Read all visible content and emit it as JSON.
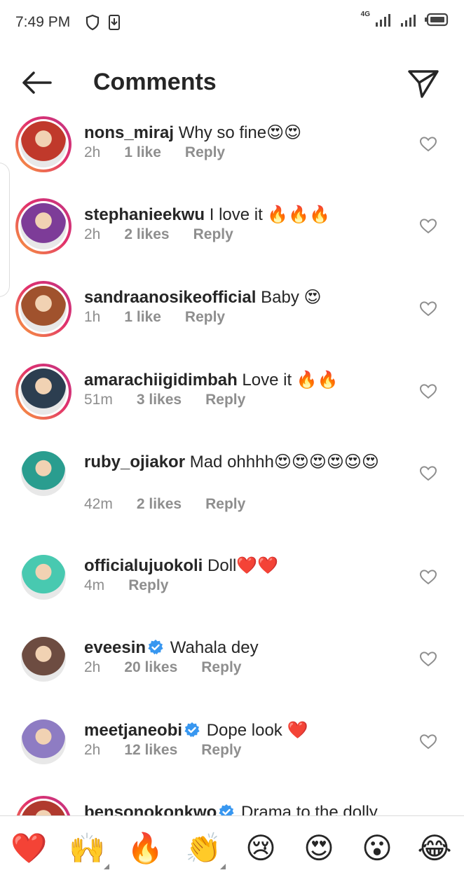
{
  "status": {
    "time": "7:49 PM",
    "network": "4G"
  },
  "header": {
    "title": "Comments"
  },
  "comments": [
    {
      "username": "nons_miraj",
      "text": "Why so fine😍😍",
      "time": "2h",
      "likes": "1 like",
      "reply": "Reply",
      "verified": false,
      "ring": true,
      "color": "#c0392b"
    },
    {
      "username": "stephanieekwu",
      "text": "I love it 🔥🔥🔥",
      "time": "2h",
      "likes": "2 likes",
      "reply": "Reply",
      "verified": false,
      "ring": true,
      "color": "#7d3c98"
    },
    {
      "username": "sandraanosikeofficial",
      "text": "Baby 😍",
      "time": "1h",
      "likes": "1 like",
      "reply": "Reply",
      "verified": false,
      "ring": true,
      "color": "#a0522d"
    },
    {
      "username": "amarachiigidimbah",
      "text": "Love it 🔥🔥",
      "time": "51m",
      "likes": "3 likes",
      "reply": "Reply",
      "verified": false,
      "ring": true,
      "color": "#2c3e50"
    },
    {
      "username": "ruby_ojiakor",
      "text": "Mad ohhhh😍😍😍😍😍😍",
      "time": "42m",
      "likes": "2 likes",
      "reply": "Reply",
      "verified": false,
      "ring": false,
      "color": "#2a9d8f"
    },
    {
      "username": "officialujuokoli",
      "text": "Doll❤️❤️",
      "time": "4m",
      "likes": "",
      "reply": "Reply",
      "verified": false,
      "ring": false,
      "color": "#48c9b0"
    },
    {
      "username": "eveesin",
      "text": "Wahala dey",
      "time": "2h",
      "likes": "20 likes",
      "reply": "Reply",
      "verified": true,
      "ring": false,
      "color": "#6d4c41"
    },
    {
      "username": "meetjaneobi",
      "text": "Dope look ❤️",
      "time": "2h",
      "likes": "12 likes",
      "reply": "Reply",
      "verified": true,
      "ring": false,
      "color": "#8e7cc3"
    },
    {
      "username": "bensonokonkwo",
      "text": "Drama to the dolly",
      "time": "",
      "likes": "",
      "reply": "",
      "verified": true,
      "ring": true,
      "color": "#b03a2e"
    }
  ],
  "reactions": [
    {
      "emoji": "❤️",
      "name": "red-heart"
    },
    {
      "emoji": "🙌",
      "name": "raising-hands"
    },
    {
      "emoji": "🔥",
      "name": "fire"
    },
    {
      "emoji": "👏",
      "name": "clapping-hands"
    },
    {
      "emoji": "😢",
      "name": "crying-face"
    },
    {
      "emoji": "😍",
      "name": "heart-eyes"
    },
    {
      "emoji": "😮",
      "name": "open-mouth"
    },
    {
      "emoji": "😂",
      "name": "tears-of-joy"
    }
  ]
}
